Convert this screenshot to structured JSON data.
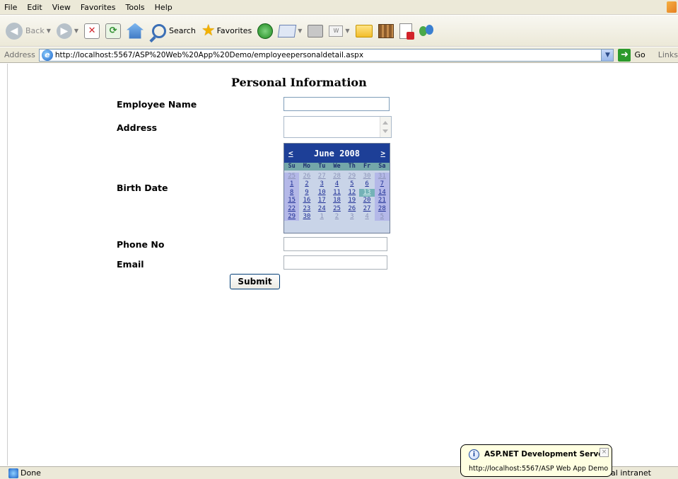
{
  "menu": [
    "File",
    "Edit",
    "View",
    "Favorites",
    "Tools",
    "Help"
  ],
  "toolbar": {
    "back_label": "Back",
    "search_label": "Search",
    "favorites_label": "Favorites"
  },
  "address": {
    "label": "Address",
    "url": "http://localhost:5567/ASP%20Web%20App%20Demo/employeepersonaldetail.aspx",
    "go_label": "Go",
    "links_label": "Links"
  },
  "page": {
    "heading": "Personal Information",
    "employee_name_label": "Employee Name",
    "address_label": "Address",
    "birth_date_label": "Birth Date",
    "phone_label": "Phone No",
    "email_label": "Email",
    "submit_label": "Submit",
    "employee_name_value": "",
    "address_value": "",
    "phone_value": "",
    "email_value": ""
  },
  "calendar": {
    "prev": "<",
    "next": ">",
    "month": "June 2008",
    "day_headers": [
      "Su",
      "Mo",
      "Tu",
      "We",
      "Th",
      "Fr",
      "Sa"
    ],
    "weeks": [
      [
        "25",
        "26",
        "27",
        "28",
        "29",
        "30",
        "31"
      ],
      [
        "1",
        "2",
        "3",
        "4",
        "5",
        "6",
        "7"
      ],
      [
        "8",
        "9",
        "10",
        "11",
        "12",
        "13",
        "14"
      ],
      [
        "15",
        "16",
        "17",
        "18",
        "19",
        "20",
        "21"
      ],
      [
        "22",
        "23",
        "24",
        "25",
        "26",
        "27",
        "28"
      ],
      [
        "29",
        "30",
        "1",
        "2",
        "3",
        "4",
        "5"
      ]
    ],
    "today": "13"
  },
  "status": {
    "text": "Done",
    "zone": "al intranet"
  },
  "balloon": {
    "title": "ASP.NET Development Server",
    "text": "http://localhost:5567/ASP Web App Demo",
    "close": "×"
  }
}
